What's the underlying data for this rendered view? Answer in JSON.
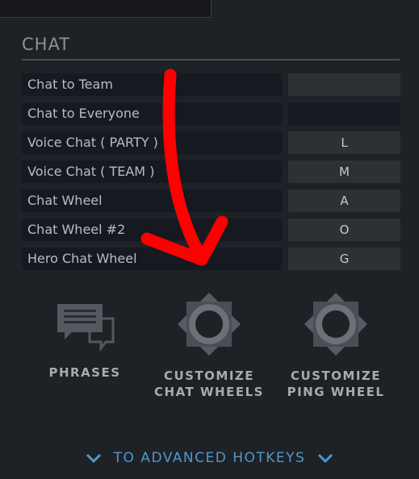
{
  "section": {
    "title": "CHAT"
  },
  "rows": [
    {
      "label": "Chat to Team",
      "key": ""
    },
    {
      "label": "Chat to Everyone",
      "key": ""
    },
    {
      "label": "Voice Chat ( PARTY )",
      "key": "L"
    },
    {
      "label": "Voice Chat ( TEAM )",
      "key": "M"
    },
    {
      "label": "Chat Wheel",
      "key": "A"
    },
    {
      "label": "Chat Wheel #2",
      "key": "O"
    },
    {
      "label": "Hero Chat Wheel",
      "key": "G"
    }
  ],
  "tiles": {
    "phrases": {
      "line1": "PHRASES",
      "icon": "chat-bubbles-icon"
    },
    "chat_wheels": {
      "line1": "CUSTOMIZE",
      "line2": "CHAT WHEELS",
      "icon": "wheel-icon"
    },
    "ping_wheel": {
      "line1": "CUSTOMIZE",
      "line2": "PING WHEEL",
      "icon": "wheel-icon"
    }
  },
  "footer": {
    "advanced_label": "TO ADVANCED HOTKEYS"
  },
  "colors": {
    "accent": "#4d99cf",
    "annotation": "#ff0000",
    "background": "#1e2126"
  }
}
